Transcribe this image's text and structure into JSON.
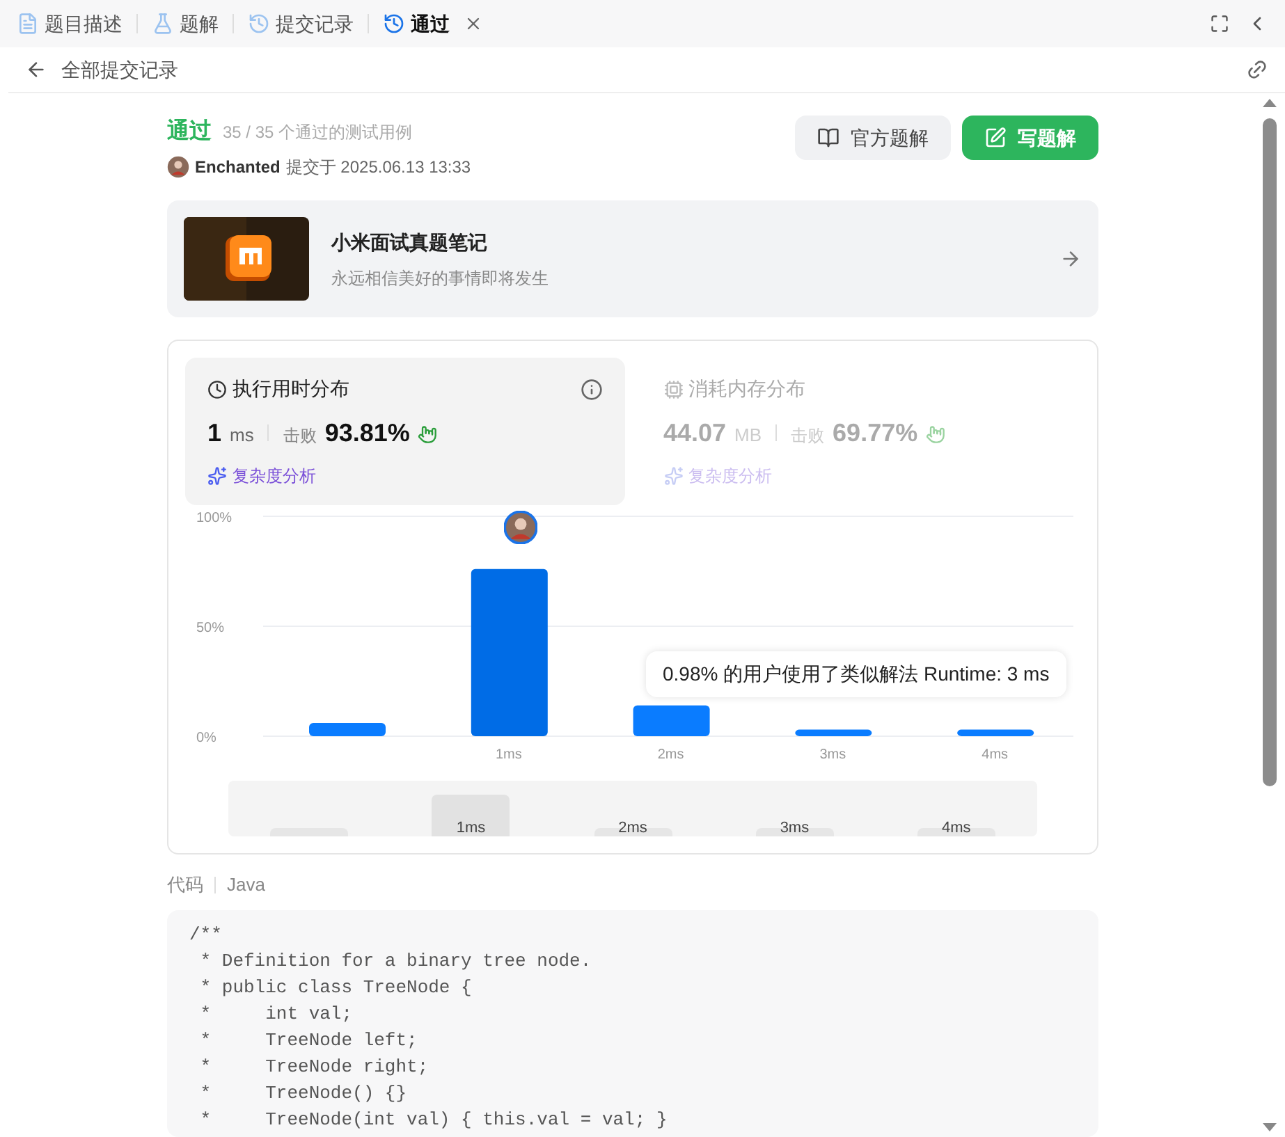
{
  "tabs": [
    {
      "kind": "doc",
      "label": "题目描述",
      "selected": false,
      "closable": false
    },
    {
      "kind": "flask",
      "label": "题解",
      "selected": false,
      "closable": false
    },
    {
      "kind": "history",
      "label": "提交记录",
      "selected": false,
      "closable": false
    },
    {
      "kind": "history",
      "label": "通过",
      "selected": true,
      "closable": true
    }
  ],
  "back_link": "全部提交记录",
  "result": {
    "status": "通过",
    "tests": "35 / 35 个通过的测试用例",
    "user": "Enchanted",
    "submitted": "提交于 2025.06.13 13:33"
  },
  "buttons": [
    {
      "kind": "book",
      "label": "官方题解"
    },
    {
      "kind": "edit",
      "label": "写题解"
    }
  ],
  "promo": {
    "title": "小米面试真题笔记",
    "subtitle": "永远相信美好的事情即将发生"
  },
  "stats": [
    {
      "kind": "clock",
      "title": "执行用时分布",
      "selected": true,
      "value": "1",
      "unit": "ms",
      "beat_label": "击败",
      "beat": "93.81%",
      "link": "复杂度分析"
    },
    {
      "kind": "chip",
      "title": "消耗内存分布",
      "selected": false,
      "value": "44.07",
      "unit": "MB",
      "beat_label": "击败",
      "beat": "69.77%",
      "link": "复杂度分析"
    }
  ],
  "chart_data": {
    "type": "bar",
    "categories": [
      null,
      "1ms",
      "2ms",
      "3ms",
      "4ms"
    ],
    "values": [
      6,
      76,
      14,
      3,
      3
    ],
    "ylim": [
      0,
      100
    ],
    "yticks": [
      {
        "value": 0,
        "label": "0%"
      },
      {
        "value": 50,
        "label": "50%"
      },
      {
        "value": 100,
        "label": "100%"
      }
    ]
  },
  "tooltip": "0.98% 的用户使用了类似解法 Runtime: 3 ms",
  "brush_labels": [
    "1ms",
    "2ms",
    "3ms",
    "4ms"
  ],
  "code_header": {
    "label": "代码",
    "language": "Java"
  },
  "code_lines": [
    "/**",
    " * Definition for a binary tree node.",
    " * public class TreeNode {",
    " *     int val;",
    " *     TreeNode left;",
    " *     TreeNode right;",
    " *     TreeNode() {}",
    " *     TreeNode(int val) { this.val = val; }"
  ]
}
